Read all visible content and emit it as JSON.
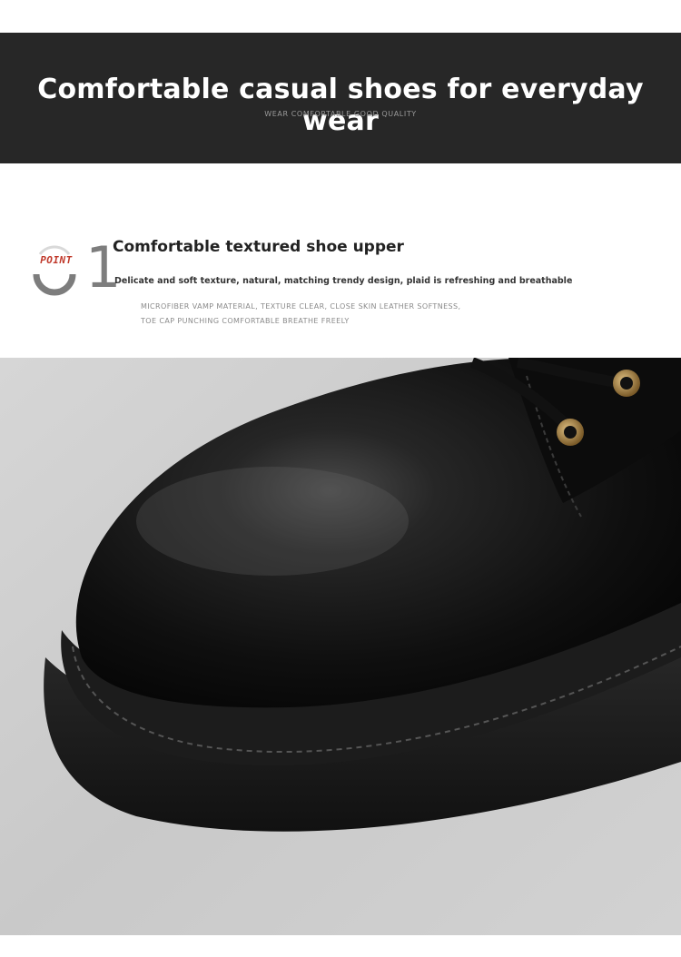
{
  "banner": {
    "title": "Comfortable casual shoes for everyday wear",
    "subtitle": "WEAR COMFORTABLE GOOD QUALITY"
  },
  "feature": {
    "point_label": "POINT",
    "number": "1",
    "title": "Comfortable textured shoe upper",
    "description": "Delicate and soft texture, natural, matching trendy design, plaid is refreshing and breathable",
    "detail_line_1": "MICROFIBER VAMP MATERIAL, TEXTURE CLEAR, CLOSE SKIN LEATHER SOFTNESS,",
    "detail_line_2": "TOE CAP PUNCHING COMFORTABLE BREATHE FREELY"
  },
  "photo": {
    "subject": "black-leather-shoe-toe",
    "colors": {
      "leather": "#121212",
      "sole": "#1a1a1a",
      "eyelet": "#b08a4a",
      "background": "#cfcfcf"
    }
  }
}
